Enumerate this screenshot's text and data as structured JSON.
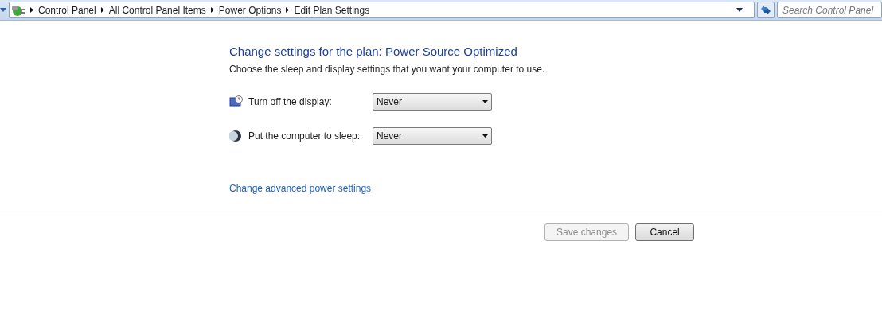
{
  "address_bar": {
    "breadcrumbs": [
      "Control Panel",
      "All Control Panel Items",
      "Power Options",
      "Edit Plan Settings"
    ]
  },
  "search": {
    "placeholder": "Search Control Panel"
  },
  "heading": "Change settings for the plan: Power Source Optimized",
  "subtitle": "Choose the sleep and display settings that you want your computer to use.",
  "settings": [
    {
      "kind": "display",
      "label": "Turn off the display:",
      "value": "Never"
    },
    {
      "kind": "sleep",
      "label": "Put the computer to sleep:",
      "value": "Never"
    }
  ],
  "advanced_link": "Change advanced power settings",
  "buttons": [
    {
      "label": "Save changes",
      "disabled": true
    },
    {
      "label": "Cancel",
      "disabled": false
    }
  ]
}
